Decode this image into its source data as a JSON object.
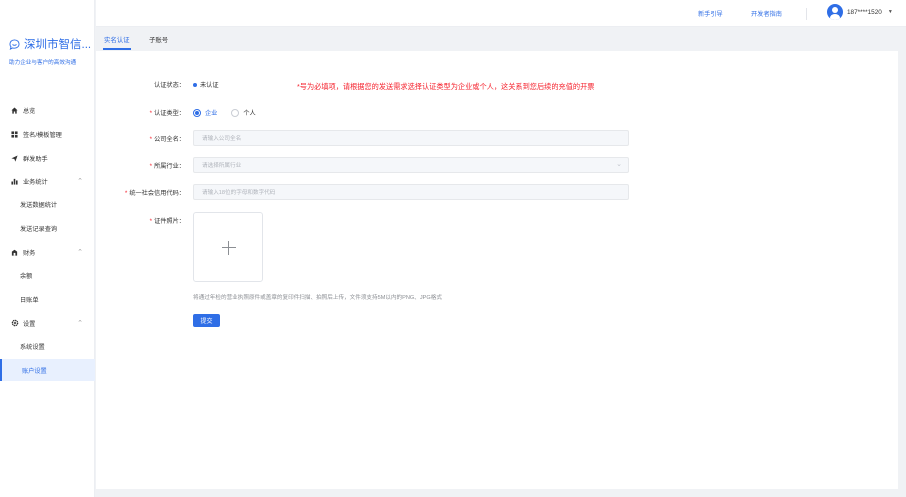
{
  "sidebar": {
    "brand_name": "深圳市智信...",
    "brand_sub": "助力企业与客户的高效沟通",
    "items": [
      {
        "label": "总览",
        "icon": "home-icon"
      },
      {
        "label": "签名/模板管理",
        "icon": "grid-icon"
      },
      {
        "label": "群发助手",
        "icon": "send-icon"
      },
      {
        "label": "业务统计",
        "icon": "bar-chart-icon"
      },
      {
        "label": "发送数据统计"
      },
      {
        "label": "发送记录查询"
      },
      {
        "label": "财务",
        "icon": "finance-icon"
      },
      {
        "label": "余额"
      },
      {
        "label": "日账单"
      },
      {
        "label": "设置",
        "icon": "gear-icon"
      },
      {
        "label": "系统设置"
      },
      {
        "label": "账户设置"
      }
    ]
  },
  "topbar": {
    "guide_label": "新手引导",
    "dev_guide_label": "开发者指南",
    "user_phone": "187****1520"
  },
  "tabs": [
    {
      "label": "实名认证",
      "active": true
    },
    {
      "label": "子账号",
      "active": false
    }
  ],
  "form": {
    "status_label": "认证状态：",
    "status_value": "未认证",
    "notice": "*号为必填项，请根据您的发送需求选择认证类型为企业或个人，这关系到您后续的充值的开票",
    "type_label": "认证类型：",
    "type_options": [
      "企业",
      "个人"
    ],
    "type_selected": "企业",
    "company_label": "公司全名：",
    "company_placeholder": "请输入公司全名",
    "industry_label": "所属行业：",
    "industry_placeholder": "请选择所属行业",
    "credit_label": "统一社会信用代码：",
    "credit_placeholder": "请输入18位的字母和数字代码",
    "photo_label": "证件照片：",
    "upload_hint": "将通过年检的营业执照原件或盖章的复印件扫描、拍照后上传，文件须支持5M以内的PNG、JPG格式",
    "submit_label": "提交"
  },
  "colors": {
    "accent": "#2f6ee6",
    "required": "#f5222d"
  }
}
